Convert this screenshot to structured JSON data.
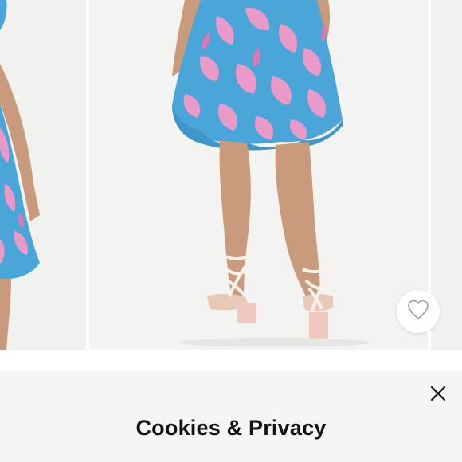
{
  "gallery": {
    "images": [
      {
        "alt": "product-image-partial-left",
        "icon": "dress-photo"
      },
      {
        "alt": "product-image-main",
        "icon": "dress-photo"
      },
      {
        "alt": "product-image-partial-right",
        "icon": "dress-photo"
      }
    ],
    "progress_fraction": 0.14
  },
  "favorite": {
    "icon": "heart-outline-icon"
  },
  "cookie_banner": {
    "title": "Cookies & Privacy",
    "close_icon": "close-icon"
  },
  "colors": {
    "dress_blue": "#4aa6d8",
    "dress_pink": "#e99ac8",
    "photo_background": "#f3f3f1",
    "sheet_background": "#f5f5f5",
    "title_text": "#111111"
  }
}
